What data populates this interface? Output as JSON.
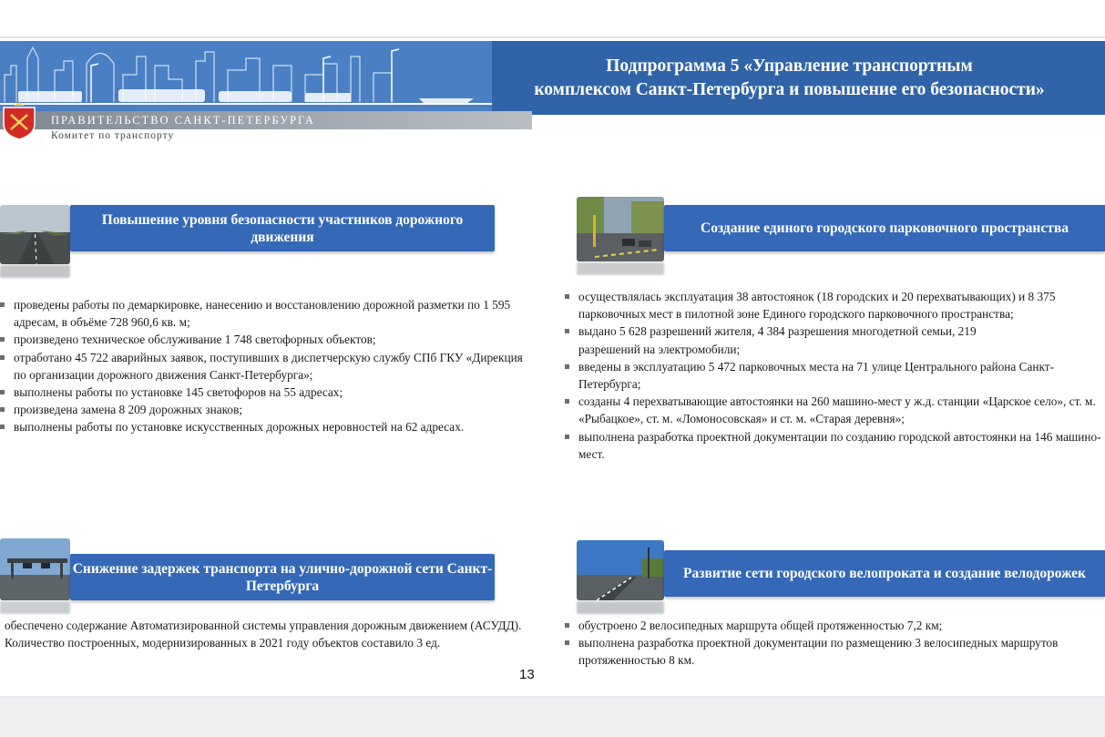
{
  "header": {
    "title_line1": "Подпрограмма 5 «Управление транспортным",
    "title_line2": "комплексом Санкт-Петербурга и повышение его безопасности»",
    "gov_name": "ПРАВИТЕЛЬСТВО САНКТ-ПЕТЕРБУРГА",
    "committee": "Комитет по транспорту"
  },
  "sections": [
    {
      "title": "Повышение уровня безопасности участников дорожного движения",
      "photo": "road-photo",
      "items": [
        "проведены работы по демаркировке, нанесению и восстановлению дорожной разметки по 1 595 адресам,  в объёме 728 960,6 кв. м;",
        "произведено техническое обслуживание 1 748 светофорных объектов;",
        "отработано 45 722 аварийных заявок, поступивших в диспетчерскую службу СПб ГКУ «Дирекция по организации дорожного движения Санкт-Петербурга»;",
        "выполнены работы по установке 145 светофоров на 55 адресах;",
        "произведена замена 8 209 дорожных знаков;",
        "выполнены работы по установке искусственных дорожных неровностей на 62 адресах."
      ]
    },
    {
      "title": "Создание единого городского парковочного пространства",
      "photo": "parking-photo",
      "items": [
        "осуществлялась эксплуатация 38 автостоянок (18 городских и 20 перехватывающих) и 8 375 парковочных мест в пилотной зоне Единого городского парковочного пространства;",
        "выдано 5 628 разрешений жителя, 4 384 разрешения многодетной семьи, 219 разрешений на электромобили;",
        "введены в эксплуатацию 5 472 парковочных места на 71 улице Центрального района Санкт-Петербурга;",
        "созданы 4 перехватывающие автостоянки на 260 машино-мест у ж.д. станции «Царское село», ст. м. «Рыбацкое», ст. м. «Ломоносовская» и ст. м. «Старая деревня»;",
        "выполнена разработка проектной документации по созданию городской автостоянки на 146 машино-мест."
      ]
    },
    {
      "title": "Снижение задержек транспорта на улично-дорожной сети Санкт-Петербурга",
      "photo": "gantry-photo",
      "items": [
        "обеспечено содержание Автоматизированной системы управления дорожным движением (АСУДД).  Количество построенных, модернизированных в 2021 году объектов  составило 3 ед."
      ]
    },
    {
      "title": "Развитие сети городского велопроката и создание велодорожек",
      "photo": "bike-lane-photo",
      "items": [
        "обустроено 2 велосипедных маршрута общей протяженностью 7,2 км;",
        "выполнена разработка проектной документации по размещению 3 велосипедных маршрутов протяженностью 8 км."
      ]
    }
  ],
  "page_number": "13",
  "colors": {
    "header_band": "#3163a8",
    "section_box": "#3568b6"
  }
}
